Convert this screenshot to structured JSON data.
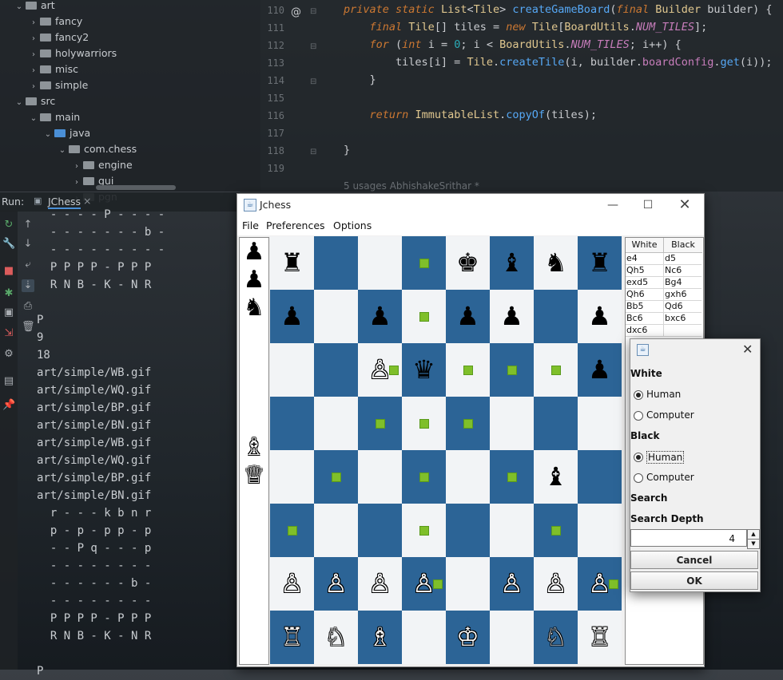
{
  "project_tree": {
    "items": [
      {
        "label": "art",
        "indent": 1
      },
      {
        "label": "fancy",
        "indent": 2
      },
      {
        "label": "fancy2",
        "indent": 2
      },
      {
        "label": "holywarriors",
        "indent": 2
      },
      {
        "label": "misc",
        "indent": 2
      },
      {
        "label": "simple",
        "indent": 2
      },
      {
        "label": "src",
        "indent": 1
      },
      {
        "label": "main",
        "indent": 2
      },
      {
        "label": "java",
        "indent": 3
      },
      {
        "label": "com.chess",
        "indent": 4
      },
      {
        "label": "engine",
        "indent": 5
      },
      {
        "label": "gui",
        "indent": 5
      },
      {
        "label": "pgn",
        "indent": 5
      }
    ]
  },
  "editor": {
    "line_numbers": [
      "110",
      "111",
      "112",
      "113",
      "114",
      "115",
      "116",
      "117",
      "118",
      "119"
    ],
    "lines": [
      "private static List<Tile> createGameBoard(final Builder builder) {",
      "    final Tile[] tiles = new Tile[BoardUtils.NUM_TILES];",
      "    for (int i = 0; i < BoardUtils.NUM_TILES; i++) {",
      "        tiles[i] = Tile.createTile(i, builder.boardConfig.get(i));",
      "    }",
      "",
      "    return ImmutableList.copyOf(tiles);",
      "",
      "}",
      ""
    ],
    "usages": "5 usages   AbhishakeSrithar *"
  },
  "run_panel": {
    "label": "Run:",
    "tab": "JChess",
    "console_lines": [
      "  - - - - P - - - -",
      "  - - - - - - - b -",
      "  - - - - - - - - -",
      "  P P P P - P P P",
      "  R N B - K - N R",
      "",
      "P",
      "9",
      "18",
      "art/simple/WB.gif",
      "art/simple/WQ.gif",
      "art/simple/BP.gif",
      "art/simple/BN.gif",
      "art/simple/WB.gif",
      "art/simple/WQ.gif",
      "art/simple/BP.gif",
      "art/simple/BN.gif",
      "  r - - - k b n r",
      "  p - p - p p - p",
      "  - - P q - - - p",
      "  - - - - - - - -",
      "  - - - - - - b -",
      "  - - - - - - - -",
      "  P P P P - P P P",
      "  R N B - K - N R",
      "",
      "P"
    ]
  },
  "jchess": {
    "title": "Jchess",
    "menus": [
      "File",
      "Preferences",
      "Options"
    ],
    "taken_pieces": [
      {
        "glyph": "♟",
        "color": "black",
        "slot": 0
      },
      {
        "glyph": "♟",
        "color": "black",
        "slot": 1
      },
      {
        "glyph": "♞",
        "color": "black",
        "slot": 2
      },
      {
        "glyph": "♗",
        "color": "white",
        "slot": 7
      },
      {
        "glyph": "♕",
        "color": "white",
        "slot": 8
      }
    ],
    "board": [
      [
        "r",
        "",
        "",
        "",
        "k",
        "b",
        "n",
        "r"
      ],
      [
        "p",
        "",
        "p",
        "",
        "p",
        "p",
        "",
        "p"
      ],
      [
        "",
        "",
        "P",
        "q",
        "",
        "",
        "",
        "p"
      ],
      [
        "",
        "",
        "",
        "",
        "",
        "",
        "",
        ""
      ],
      [
        "",
        "",
        "",
        "",
        "",
        "",
        "b",
        ""
      ],
      [
        "",
        "",
        "",
        "",
        "",
        "",
        "",
        ""
      ],
      [
        "P",
        "P",
        "P",
        "P",
        "",
        "P",
        "P",
        "P"
      ],
      [
        "R",
        "N",
        "B",
        "",
        "K",
        "",
        "N",
        "R"
      ]
    ],
    "highlights": [
      [
        0,
        3
      ],
      [
        1,
        3
      ],
      [
        2,
        2
      ],
      [
        2,
        4
      ],
      [
        2,
        5
      ],
      [
        2,
        6
      ],
      [
        3,
        2
      ],
      [
        3,
        3
      ],
      [
        3,
        4
      ],
      [
        4,
        1
      ],
      [
        4,
        3
      ],
      [
        4,
        5
      ],
      [
        5,
        0
      ],
      [
        5,
        3
      ],
      [
        5,
        6
      ],
      [
        6,
        3
      ],
      [
        6,
        7
      ]
    ],
    "colors": {
      "light": "#f2f4f6",
      "dark": "#2c6496",
      "highlight": "#7fbf2a"
    },
    "move_history": {
      "headers": [
        "White",
        "Black"
      ],
      "rows": [
        [
          "e4",
          "d5"
        ],
        [
          "Qh5",
          "Nc6"
        ],
        [
          "exd5",
          "Bg4"
        ],
        [
          "Qh6",
          "gxh6"
        ],
        [
          "Bb5",
          "Qd6"
        ],
        [
          "Bc6",
          "bxc6"
        ],
        [
          "dxc6",
          ""
        ]
      ]
    }
  },
  "setup_dialog": {
    "white_label": "White",
    "black_label": "Black",
    "human_label": "Human",
    "computer_label": "Computer",
    "white_selected": "Human",
    "black_selected": "Human",
    "search_label": "Search",
    "search_depth_label": "Search Depth",
    "search_depth_value": "4",
    "cancel_label": "Cancel",
    "ok_label": "OK"
  }
}
